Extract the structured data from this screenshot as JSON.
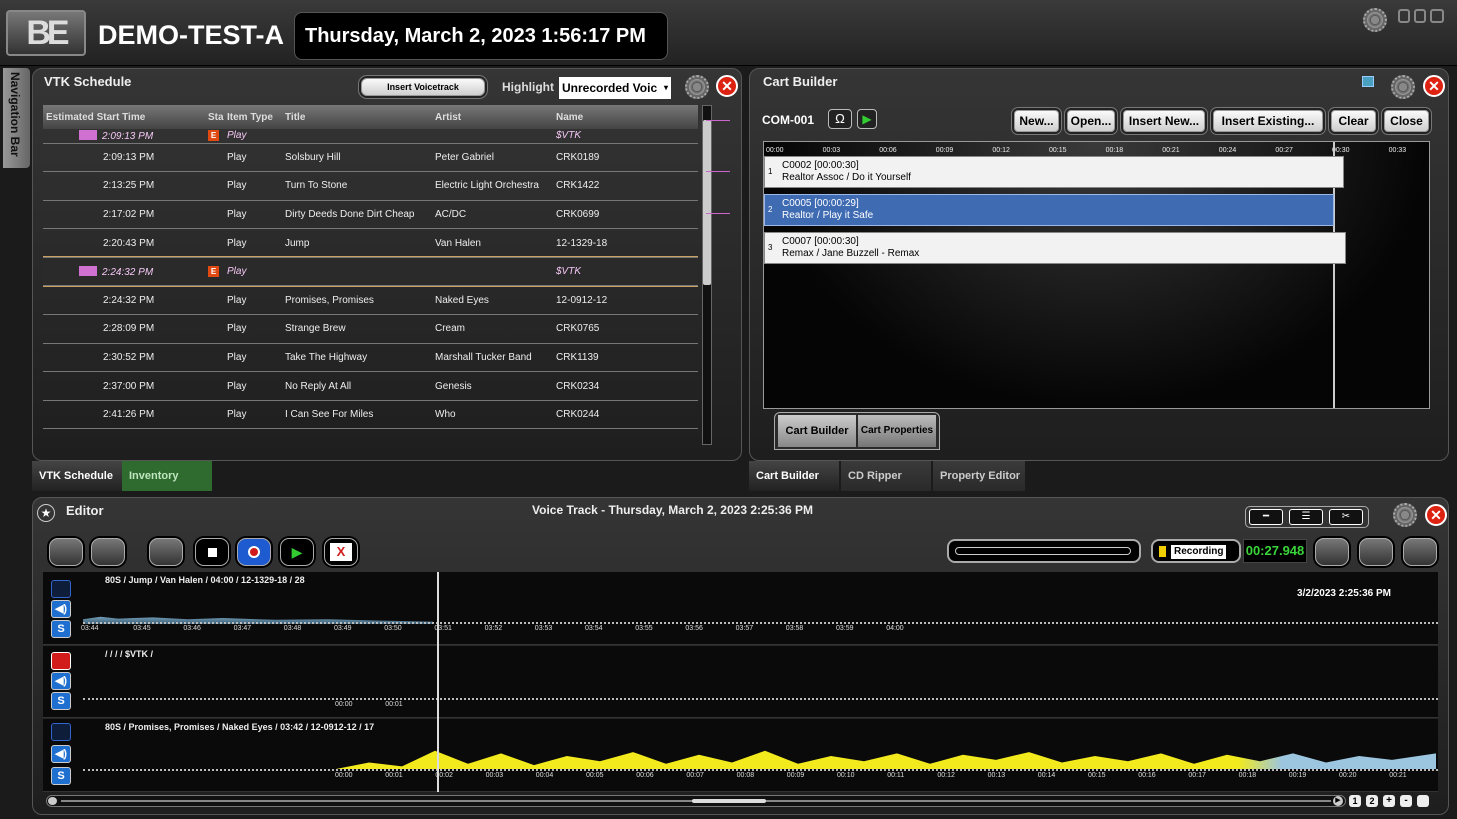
{
  "topbar": {
    "station": "DEMO-TEST-A",
    "datetime": "Thursday, March 2, 2023 1:56:17 PM",
    "logo": "BE"
  },
  "navbar": {
    "label": "Navigation Bar"
  },
  "vtk": {
    "title": "VTK Schedule",
    "insert_voicetrack": "Insert Voicetrack",
    "highlight_label": "Highlight",
    "highlight_value": "Unrecorded Voic",
    "columns": [
      "Estimated Start Time",
      "Sta",
      "Item Type",
      "Title",
      "Artist",
      "Name"
    ],
    "rows": [
      {
        "time": "2:09:13 PM",
        "type": "Play",
        "title": "",
        "artist": "",
        "name": "$VTK",
        "vtk": true,
        "partial": true
      },
      {
        "time": "2:09:13 PM",
        "type": "Play",
        "title": "Solsbury Hill",
        "artist": "Peter Gabriel",
        "name": "CRK0189"
      },
      {
        "time": "2:13:25 PM",
        "type": "Play",
        "title": "Turn To Stone",
        "artist": "Electric Light Orchestra",
        "name": "CRK1422"
      },
      {
        "time": "2:17:02 PM",
        "type": "Play",
        "title": "Dirty Deeds Done Dirt Cheap",
        "artist": "AC/DC",
        "name": "CRK0699"
      },
      {
        "time": "2:20:43 PM",
        "type": "Play",
        "title": "Jump",
        "artist": "Van Halen",
        "name": "12-1329-18"
      },
      {
        "time": "2:24:32 PM",
        "type": "Play",
        "title": "",
        "artist": "",
        "name": "$VTK",
        "vtk": true,
        "selected": true
      },
      {
        "time": "2:24:32 PM",
        "type": "Play",
        "title": "Promises, Promises",
        "artist": "Naked Eyes",
        "name": "12-0912-12"
      },
      {
        "time": "2:28:09 PM",
        "type": "Play",
        "title": "Strange Brew",
        "artist": "Cream",
        "name": "CRK0765"
      },
      {
        "time": "2:30:52 PM",
        "type": "Play",
        "title": "Take The Highway",
        "artist": "Marshall Tucker Band",
        "name": "CRK1139"
      },
      {
        "time": "2:37:00 PM",
        "type": "Play",
        "title": "No Reply At All",
        "artist": "Genesis",
        "name": "CRK0234"
      },
      {
        "time": "2:41:26 PM",
        "type": "Play",
        "title": "I Can See For Miles",
        "artist": "Who",
        "name": "CRK0244"
      }
    ],
    "tabs": [
      "VTK Schedule",
      "Inventory"
    ],
    "badge_letter": "E"
  },
  "cart": {
    "title": "Cart Builder",
    "cart_id": "COM-001",
    "buttons": [
      "New...",
      "Open...",
      "Insert New...",
      "Insert Existing...",
      "Clear",
      "Close"
    ],
    "ticks": [
      "00:00",
      "00:03",
      "00:06",
      "00:09",
      "00:12",
      "00:15",
      "00:18",
      "00:21",
      "00:24",
      "00:27",
      "00:30",
      "00:33"
    ],
    "items": [
      {
        "num": "1",
        "line1": "C0002 [00:00:30]",
        "line2": "Realtor Assoc / Do it Yourself"
      },
      {
        "num": "2",
        "line1": "C0005 [00:00:29]",
        "line2": "Realtor / Play it Safe",
        "selected": true
      },
      {
        "num": "3",
        "line1": "C0007 [00:00:30]",
        "line2": "Remax / Jane Buzzell - Remax"
      }
    ],
    "inner_tabs": [
      "Cart Builder",
      "Cart Properties"
    ],
    "tabs": [
      "Cart Builder",
      "CD Ripper",
      "Property Editor"
    ]
  },
  "editor": {
    "title": "Editor",
    "voice_track": "Voice Track - Thursday, March 2, 2023 2:25:36 PM",
    "recording": "Recording",
    "elapsed": "00:27.948",
    "record_button_icon": "record-icon",
    "tracks": [
      {
        "label": "80S / Jump / Van Halen / 04:00 / 12-1329-18 / 28",
        "timestamp": "3/2/2023 2:25:36 PM",
        "ticks": [
          "03:44",
          "03:45",
          "03:46",
          "03:47",
          "03:48",
          "03:49",
          "03:50",
          "03:51",
          "03:52",
          "03:53",
          "03:54",
          "03:55",
          "03:56",
          "03:57",
          "03:58",
          "03:59",
          "04:00"
        ]
      },
      {
        "label": "/ / / / $VTK /",
        "ticks": [
          "00:00",
          "00:01"
        ]
      },
      {
        "label": "80S / Promises, Promises / Naked Eyes / 03:42 / 12-0912-12 / 17",
        "ticks": [
          "00:00",
          "00:01",
          "00:02",
          "00:03",
          "00:04",
          "00:05",
          "00:06",
          "00:07",
          "00:08",
          "00:09",
          "00:10",
          "00:11",
          "00:12",
          "00:13",
          "00:14",
          "00:15",
          "00:16",
          "00:17",
          "00:18",
          "00:19",
          "00:20",
          "00:21"
        ]
      }
    ],
    "zoom_buttons": [
      "1",
      "2",
      "+",
      "-"
    ],
    "s_label": "S",
    "delete_label": "X"
  },
  "colors": {
    "accent_pink": "#d070d0",
    "badge_orange": "#e04a12",
    "selected_blue": "#3f6bb3",
    "waveform_yellow": "#f2ea1c",
    "waveform_blue": "#9cc6e0",
    "record_red": "#d21c1c"
  }
}
